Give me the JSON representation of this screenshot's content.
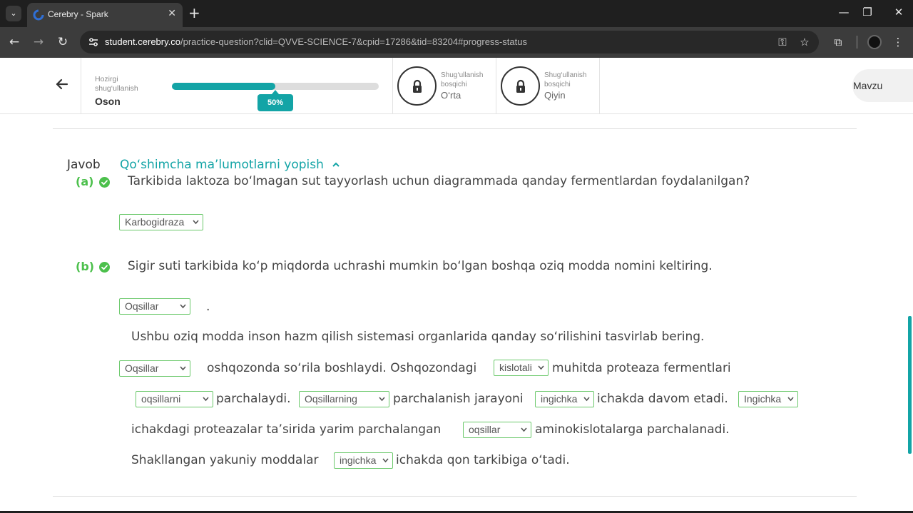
{
  "browser": {
    "tab_title": "Cerebry - Spark",
    "url_host": "student.cerebry.co",
    "url_path": "/practice-question?clid=QVVE-SCIENCE-7&cpid=17286&tid=83204#progress-status"
  },
  "header": {
    "current_label": "Hozirgi shug‘ullanish",
    "current_level": "Oson",
    "progress_percent": 50,
    "progress_text": "50%",
    "levels": [
      {
        "small": "Shug‘ullanish bosqichi",
        "name": "O‘rta",
        "locked": true
      },
      {
        "small": "Shug‘ullanish bosqichi",
        "name": "Qiyin",
        "locked": true
      }
    ],
    "topic_button": "Mavzu"
  },
  "answer": {
    "label": "Javob",
    "toggle_text": "Qo‘shimcha ma’lumotlarni yopish",
    "toggle_icon": "chevron-up-icon",
    "accent_color": "#13a4a6",
    "correct_color": "#4cc04c"
  },
  "part_a": {
    "label": "(a)",
    "question": "Tarkibida laktoza bo‘lmagan sut tayyorlash uchun diagrammada qanday fermentlardan foydalanilgan?",
    "select": "Karbogidraza"
  },
  "part_b": {
    "label": "(b)",
    "question": "Sigir suti tarkibida ko‘p miqdorda uchrashi mumkin bo‘lgan boshqa oziq modda nomini keltiring.",
    "select1": "Oqsillar",
    "dot": ".",
    "instruction": "Ushbu oziq modda inson hazm qilish sistemasi organlarida qanday so‘rilishini tasvirlab bering.",
    "line1": {
      "select_a": "Oqsillar",
      "text_a": "oshqozonda so‘rila boshlaydi. Oshqozondagi",
      "select_b": "kislotali",
      "text_b": "muhitda proteaza fermentlari"
    },
    "line2": {
      "select_a": "oqsillarni",
      "text_a": "parchalaydi.",
      "select_b": "Oqsillarning",
      "text_b": "parchalanish jarayoni",
      "select_c": "ingichka",
      "text_c": "ichakda davom etadi.",
      "select_d": "Ingichka"
    },
    "line3": {
      "text_a": "ichakdagi proteazalar ta’sirida yarim parchalangan",
      "select_a": "oqsillar",
      "text_b": "aminokislotalarga parchalanadi."
    },
    "line4": {
      "text_a": "Shakllangan yakuniy moddalar",
      "select_a": "ingichka",
      "text_b": "ichakda qon tarkibiga o‘tadi."
    }
  }
}
